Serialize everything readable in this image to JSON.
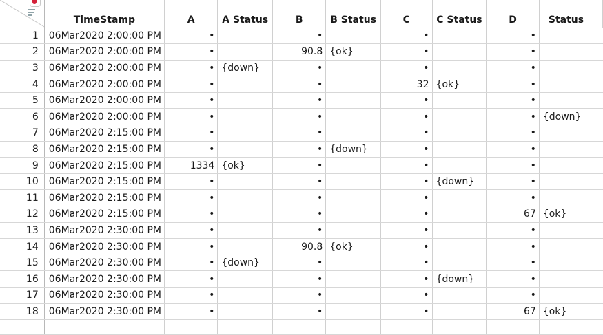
{
  "table": {
    "columns": [
      "TimeStamp",
      "A",
      "A Status",
      "B",
      "B Status",
      "C",
      "C Status",
      "D",
      "Status"
    ],
    "rows": [
      {
        "n": "1",
        "ts": "06Mar2020 2:00:00 PM",
        "a": "•",
        "as": "",
        "b": "•",
        "bs": "",
        "c": "•",
        "cs": "",
        "d": "•",
        "s": ""
      },
      {
        "n": "2",
        "ts": "06Mar2020 2:00:00 PM",
        "a": "•",
        "as": "",
        "b": "90.8",
        "bs": "{ok}",
        "c": "•",
        "cs": "",
        "d": "•",
        "s": ""
      },
      {
        "n": "3",
        "ts": "06Mar2020 2:00:00 PM",
        "a": "•",
        "as": "{down}",
        "b": "•",
        "bs": "",
        "c": "•",
        "cs": "",
        "d": "•",
        "s": ""
      },
      {
        "n": "4",
        "ts": "06Mar2020 2:00:00 PM",
        "a": "•",
        "as": "",
        "b": "•",
        "bs": "",
        "c": "32",
        "cs": "{ok}",
        "d": "•",
        "s": ""
      },
      {
        "n": "5",
        "ts": "06Mar2020 2:00:00 PM",
        "a": "•",
        "as": "",
        "b": "•",
        "bs": "",
        "c": "•",
        "cs": "",
        "d": "•",
        "s": ""
      },
      {
        "n": "6",
        "ts": "06Mar2020 2:00:00 PM",
        "a": "•",
        "as": "",
        "b": "•",
        "bs": "",
        "c": "•",
        "cs": "",
        "d": "•",
        "s": "{down}"
      },
      {
        "n": "7",
        "ts": "06Mar2020 2:15:00 PM",
        "a": "•",
        "as": "",
        "b": "•",
        "bs": "",
        "c": "•",
        "cs": "",
        "d": "•",
        "s": ""
      },
      {
        "n": "8",
        "ts": "06Mar2020 2:15:00 PM",
        "a": "•",
        "as": "",
        "b": "•",
        "bs": "{down}",
        "c": "•",
        "cs": "",
        "d": "•",
        "s": ""
      },
      {
        "n": "9",
        "ts": "06Mar2020 2:15:00 PM",
        "a": "1334",
        "as": "{ok}",
        "b": "•",
        "bs": "",
        "c": "•",
        "cs": "",
        "d": "•",
        "s": ""
      },
      {
        "n": "10",
        "ts": "06Mar2020 2:15:00 PM",
        "a": "•",
        "as": "",
        "b": "•",
        "bs": "",
        "c": "•",
        "cs": "{down}",
        "d": "•",
        "s": ""
      },
      {
        "n": "11",
        "ts": "06Mar2020 2:15:00 PM",
        "a": "•",
        "as": "",
        "b": "•",
        "bs": "",
        "c": "•",
        "cs": "",
        "d": "•",
        "s": ""
      },
      {
        "n": "12",
        "ts": "06Mar2020 2:15:00 PM",
        "a": "•",
        "as": "",
        "b": "•",
        "bs": "",
        "c": "•",
        "cs": "",
        "d": "67",
        "s": "{ok}"
      },
      {
        "n": "13",
        "ts": "06Mar2020 2:30:00 PM",
        "a": "•",
        "as": "",
        "b": "•",
        "bs": "",
        "c": "•",
        "cs": "",
        "d": "•",
        "s": ""
      },
      {
        "n": "14",
        "ts": "06Mar2020 2:30:00 PM",
        "a": "•",
        "as": "",
        "b": "90.8",
        "bs": "{ok}",
        "c": "•",
        "cs": "",
        "d": "•",
        "s": ""
      },
      {
        "n": "15",
        "ts": "06Mar2020 2:30:00 PM",
        "a": "•",
        "as": "{down}",
        "b": "•",
        "bs": "",
        "c": "•",
        "cs": "",
        "d": "•",
        "s": ""
      },
      {
        "n": "16",
        "ts": "06Mar2020 2:30:00 PM",
        "a": "•",
        "as": "",
        "b": "•",
        "bs": "",
        "c": "•",
        "cs": "{down}",
        "d": "•",
        "s": ""
      },
      {
        "n": "17",
        "ts": "06Mar2020 2:30:00 PM",
        "a": "•",
        "as": "",
        "b": "•",
        "bs": "",
        "c": "•",
        "cs": "",
        "d": "•",
        "s": ""
      },
      {
        "n": "18",
        "ts": "06Mar2020 2:30:00 PM",
        "a": "•",
        "as": "",
        "b": "•",
        "bs": "",
        "c": "•",
        "cs": "",
        "d": "67",
        "s": "{ok}"
      }
    ]
  },
  "icons": {
    "corner_marker": "red-triangle-menu-icon",
    "corner_lines": "rows-list-icon"
  },
  "colors": {
    "marker_red": "#d4213a",
    "grid_line": "#d0d0d0"
  }
}
